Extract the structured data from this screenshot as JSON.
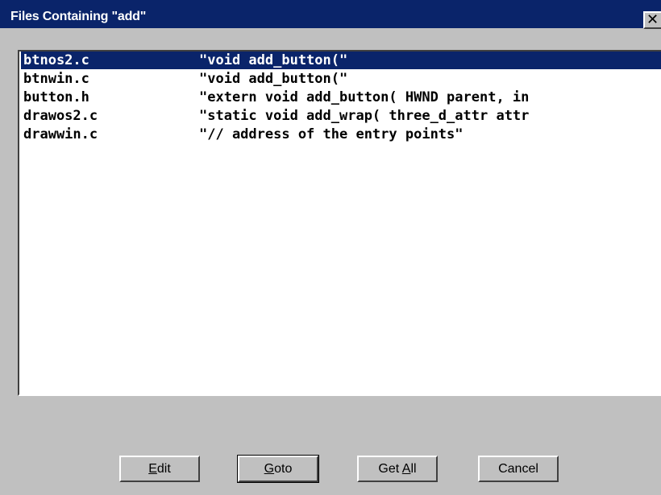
{
  "window": {
    "title": "Files Containing \"add\"",
    "close_glyph": "✕"
  },
  "results": [
    {
      "file": "btnos2.c",
      "match": "\"void add_button(\"",
      "selected": true
    },
    {
      "file": "btnwin.c",
      "match": "\"void add_button(\"",
      "selected": false
    },
    {
      "file": "button.h",
      "match": "\"extern void add_button( HWND parent, in",
      "selected": false
    },
    {
      "file": "drawos2.c",
      "match": "\"static void add_wrap( three_d_attr attr",
      "selected": false
    },
    {
      "file": "drawwin.c",
      "match": "\"// address of the entry points\"",
      "selected": false
    }
  ],
  "buttons": {
    "edit": {
      "pre": "",
      "accel": "E",
      "post": "dit"
    },
    "goto": {
      "pre": "",
      "accel": "G",
      "post": "oto"
    },
    "get_all": {
      "pre": "Get ",
      "accel": "A",
      "post": "ll"
    },
    "cancel": {
      "pre": "Cancel",
      "accel": "",
      "post": ""
    }
  },
  "colors": {
    "title_bar": "#0a246a",
    "face": "#c0c0c0",
    "selection": "#0a246a"
  }
}
